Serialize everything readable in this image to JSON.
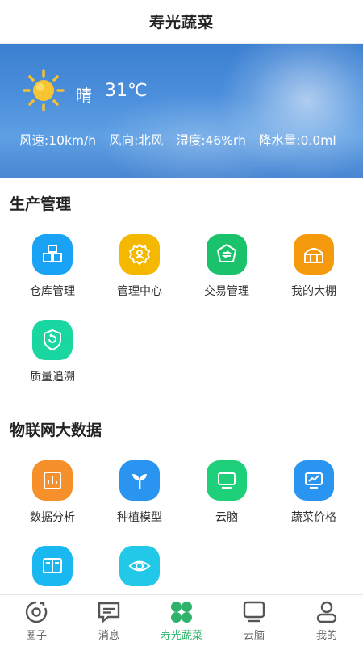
{
  "header": {
    "title": "寿光蔬菜"
  },
  "weather": {
    "icon": "sun-icon",
    "condition": "晴",
    "temperature": "31℃",
    "stats": [
      "风速:10km/h",
      "风向:北风",
      "湿度:46%rh",
      "降水量:0.0ml"
    ]
  },
  "production": {
    "title": "生产管理",
    "items": [
      {
        "label": "仓库管理",
        "icon": "warehouse-icon",
        "color": "#1aa3f5"
      },
      {
        "label": "管理中心",
        "icon": "gear-person-icon",
        "color": "#f5b800"
      },
      {
        "label": "交易管理",
        "icon": "exchange-icon",
        "color": "#19c26b"
      },
      {
        "label": "我的大棚",
        "icon": "greenhouse-icon",
        "color": "#f59a0c"
      },
      {
        "label": "质量追溯",
        "icon": "trace-shield-icon",
        "color": "#1ad6a0"
      }
    ]
  },
  "iot": {
    "title": "物联网大数据",
    "items": [
      {
        "label": "数据分析",
        "icon": "chart-icon",
        "color": "#f5902a"
      },
      {
        "label": "种植模型",
        "icon": "sprout-icon",
        "color": "#2a95f0"
      },
      {
        "label": "云脑",
        "icon": "monitor-icon",
        "color": "#1fd07a"
      },
      {
        "label": "蔬菜价格",
        "icon": "price-screen-icon",
        "color": "#2a95f0"
      },
      {
        "label": "",
        "icon": "book-icon",
        "color": "#1ab8f0"
      },
      {
        "label": "",
        "icon": "eye-icon",
        "color": "#22c8e8"
      }
    ]
  },
  "tabbar": {
    "active_color": "#2fb36b",
    "tabs": [
      {
        "label": "圈子",
        "icon": "circle-icon"
      },
      {
        "label": "消息",
        "icon": "message-icon"
      },
      {
        "label": "寿光蔬菜",
        "icon": "clover-icon"
      },
      {
        "label": "云脑",
        "icon": "monitor-icon"
      },
      {
        "label": "我的",
        "icon": "user-icon"
      }
    ]
  }
}
